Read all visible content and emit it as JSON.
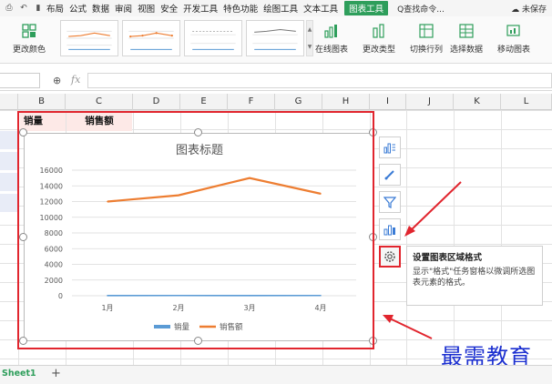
{
  "menubar": {
    "items": [
      "布局",
      "公式",
      "数据",
      "审阅",
      "视图",
      "安全",
      "开发工具",
      "特色功能",
      "绘图工具",
      "文本工具"
    ],
    "active_tab": "图表工具",
    "search": "Q查找命令...",
    "save_status": "未保存"
  },
  "ribbon": {
    "change_color": "更改颜色",
    "online_chart": "在线图表",
    "change_type": "更改类型",
    "switch_row_col": "切换行列",
    "select_data": "选择数据",
    "move_chart": "移动图表"
  },
  "formula_bar": {
    "fx_label": "fx"
  },
  "columns": [
    "B",
    "C",
    "D",
    "E",
    "F",
    "G",
    "H",
    "I",
    "J",
    "K",
    "L"
  ],
  "table_headers": {
    "sales_volume": "销量",
    "sales_amount": "销售额"
  },
  "chart_data": {
    "type": "line",
    "title": "图表标题",
    "categories": [
      "1月",
      "2月",
      "3月",
      "4月"
    ],
    "series": [
      {
        "name": "销量",
        "values": [
          20,
          30,
          25,
          28
        ],
        "color": "#5b9bd5"
      },
      {
        "name": "销售额",
        "values": [
          12000,
          12800,
          15000,
          13000
        ],
        "color": "#ed7d31"
      }
    ],
    "yticks": [
      "0",
      "2000",
      "4000",
      "6000",
      "8000",
      "10000",
      "12000",
      "14000",
      "16000"
    ],
    "ylim": [
      0,
      16000
    ],
    "grid": true,
    "legend": "bottom"
  },
  "tooltip": {
    "title": "设置图表区域格式",
    "description": "显示\"格式\"任务窗格以微调所选图表元素的格式。"
  },
  "watermark": "最需教育",
  "sheets": {
    "active": "Sheet1"
  },
  "colors": {
    "accent_green": "#2e9e5b",
    "highlight_red": "#e1252e",
    "watermark_blue": "#1b2fd0"
  }
}
